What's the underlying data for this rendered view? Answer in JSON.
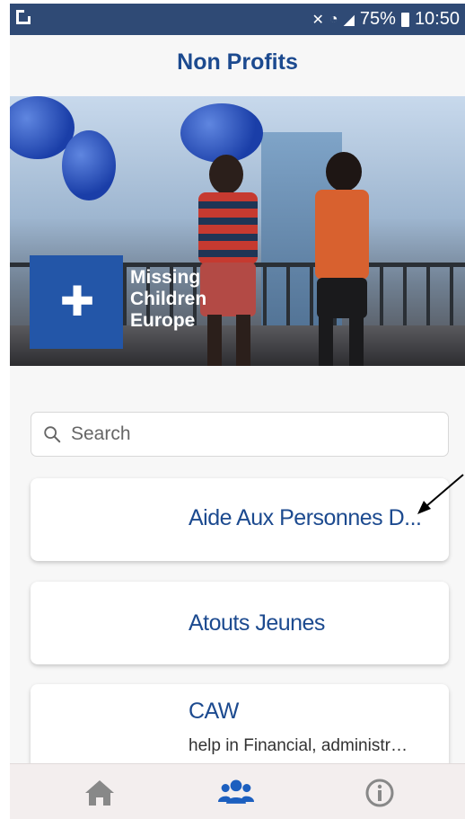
{
  "status_bar": {
    "battery": "75%",
    "time": "10:50"
  },
  "header": {
    "title": "Non Profits"
  },
  "hero": {
    "logo_line1": "Missing",
    "logo_line2": "Children",
    "logo_line3": "Europe"
  },
  "search": {
    "placeholder": "Search"
  },
  "nonprofits": [
    {
      "name": "Aide Aux Personnes D...",
      "description": ""
    },
    {
      "name": "Atouts Jeunes",
      "description": ""
    },
    {
      "name": "CAW",
      "description": "help in Financial, administr…"
    }
  ],
  "bottom_nav": {
    "items": [
      {
        "icon": "home-icon",
        "active": false
      },
      {
        "icon": "users-icon",
        "active": true
      },
      {
        "icon": "info-icon",
        "active": false
      }
    ]
  },
  "colors": {
    "primary": "#1c4a8f",
    "statusbar": "#2f4a75",
    "inactive": "#888888"
  }
}
